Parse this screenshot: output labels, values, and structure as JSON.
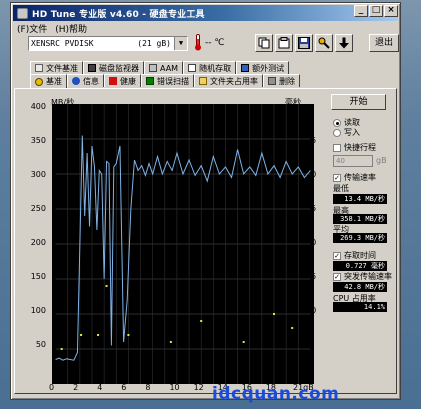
{
  "window": {
    "title": "HD Tune 专业版 v4.60 - 硬盘专业工具"
  },
  "menu": {
    "file": "(F)文件",
    "help": "(H)帮助"
  },
  "toolbar": {
    "drive_name": "XENSRC  PVDISK",
    "drive_capacity": "(21 gB)",
    "temperature": "-- ℃",
    "exit_label": "退出"
  },
  "tabs": {
    "row1": [
      "文件基准",
      "磁盘监视器",
      "AAM",
      "随机存取",
      "额外测试"
    ],
    "row2": [
      "基准",
      "信息",
      "健康",
      "错误扫描",
      "文件夹占用率",
      "删除"
    ]
  },
  "graph": {
    "unit_left": "MB/秒",
    "unit_right": "毫秒",
    "left_ticks": [
      "400",
      "350",
      "300",
      "250",
      "200",
      "150",
      "100",
      "50"
    ],
    "right_ticks": [
      "40",
      "35",
      "30",
      "25",
      "20",
      "15",
      "10",
      "5"
    ],
    "x_ticks": [
      "0",
      "2",
      "4",
      "6",
      "8",
      "10",
      "12",
      "14",
      "16",
      "18",
      "21gB"
    ]
  },
  "chart_data": {
    "type": "line",
    "ylabel": "MB/秒",
    "y2label": "毫秒",
    "ylim": [
      0,
      400
    ],
    "y2lim": [
      0,
      40
    ],
    "xlim": [
      0,
      21
    ],
    "x_unit": "gB",
    "grid": true,
    "series": [
      {
        "color": "#7fb2e5",
        "x": [
          0,
          0.3,
          0.6,
          0.9,
          1.2,
          1.5,
          1.8,
          2.0,
          2.2,
          2.4,
          2.6,
          2.8,
          3.0,
          3.2,
          3.4,
          3.6,
          3.8,
          4.0,
          4.2,
          4.4,
          4.6,
          4.8,
          5.0,
          5.3,
          5.6,
          5.9,
          6.2,
          6.5,
          6.8,
          7.1,
          7.4,
          7.7,
          8.0,
          8.4,
          8.8,
          9.2,
          9.6,
          10.0,
          10.5,
          11.0,
          11.5,
          12.0,
          12.5,
          13.0,
          13.5,
          14.0,
          14.5,
          15.0,
          15.5,
          16.0,
          16.5,
          17.0,
          17.5,
          18.0,
          18.5,
          19.0,
          19.5,
          20.0,
          20.5,
          21.0
        ],
        "values": [
          35,
          37,
          34,
          36,
          35,
          34,
          45,
          200,
          355,
          240,
          330,
          225,
          340,
          310,
          220,
          305,
          300,
          150,
          318,
          315,
          55,
          310,
          315,
          340,
          60,
          120,
          250,
          320,
          305,
          312,
          298,
          315,
          300,
          325,
          300,
          318,
          305,
          330,
          300,
          320,
          298,
          312,
          290,
          325,
          300,
          310,
          295,
          335,
          300,
          310,
          298,
          330,
          300,
          312,
          295,
          318,
          300,
          310,
          295,
          305
        ]
      }
    ],
    "access_time_points": [
      [
        0.5,
        5
      ],
      [
        2.1,
        7
      ],
      [
        3.5,
        7
      ],
      [
        4.2,
        14
      ],
      [
        6.0,
        7
      ],
      [
        9.5,
        6
      ],
      [
        12.0,
        9
      ],
      [
        15.5,
        6
      ],
      [
        18.0,
        10
      ],
      [
        19.5,
        8
      ]
    ]
  },
  "controls": {
    "start_label": "开始",
    "read_label": "读取",
    "write_label": "写入",
    "short_stroke_label": "快捷行程",
    "short_stroke_value": "40",
    "short_stroke_unit": "gB",
    "transfer_rate_label": "传输速率",
    "min_label": "最低",
    "min_value": "13.4 MB/秒",
    "max_label": "最高",
    "max_value": "358.1 MB/秒",
    "avg_label": "平均",
    "avg_value": "269.3 MB/秒",
    "access_time_label": "存取时间",
    "access_time_value": "0.727 毫秒",
    "burst_rate_label": "突发传输速率",
    "burst_rate_value": "42.8 MB/秒",
    "cpu_label": "CPU 占用率",
    "cpu_value": "14.1%"
  },
  "watermark": "idcquan.com"
}
